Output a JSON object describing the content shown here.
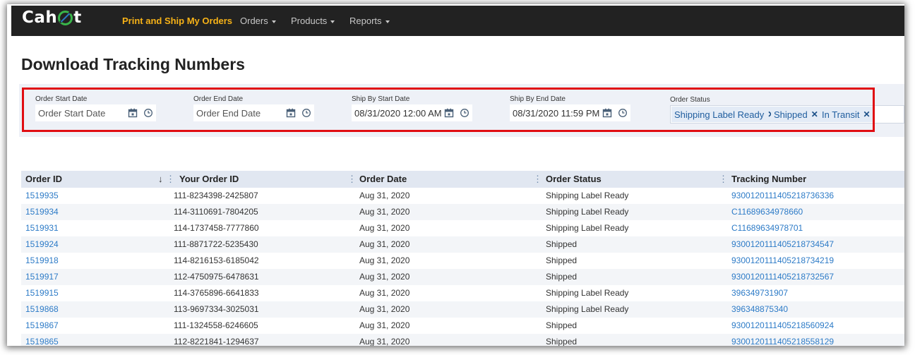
{
  "app": {
    "logo_text": "Cahoot",
    "logo_prefix": "Cah",
    "logo_suffix": "t"
  },
  "nav": {
    "print_ship": "Print and Ship My Orders",
    "orders": "Orders",
    "products": "Products",
    "reports": "Reports"
  },
  "page": {
    "title": "Download Tracking Numbers"
  },
  "filters": {
    "order_start": {
      "label": "Order Start Date",
      "placeholder": "Order Start Date",
      "value": ""
    },
    "order_end": {
      "label": "Order End Date",
      "placeholder": "Order End Date",
      "value": ""
    },
    "ship_start": {
      "label": "Ship By Start Date",
      "placeholder": "",
      "value": "08/31/2020 12:00 AM"
    },
    "ship_end": {
      "label": "Ship By End Date",
      "placeholder": "",
      "value": "08/31/2020 11:59 PM"
    },
    "order_status": {
      "label": "Order Status",
      "chips": [
        "Shipping Label Ready",
        "Shipped",
        "In Transit"
      ]
    }
  },
  "table": {
    "columns": [
      "Order ID",
      "Your Order ID",
      "Order Date",
      "Order Status",
      "Tracking Number"
    ],
    "sort_indicator": "↓",
    "rows": [
      {
        "order_id": "1519935",
        "your_order_id": "111-8234398-2425807",
        "order_date": "Aug 31, 2020",
        "status": "Shipping Label Ready",
        "tracking": "9300120111405218736336"
      },
      {
        "order_id": "1519934",
        "your_order_id": "114-3110691-7804205",
        "order_date": "Aug 31, 2020",
        "status": "Shipping Label Ready",
        "tracking": "C11689634978660"
      },
      {
        "order_id": "1519931",
        "your_order_id": "114-1737458-7777860",
        "order_date": "Aug 31, 2020",
        "status": "Shipping Label Ready",
        "tracking": "C11689634978701"
      },
      {
        "order_id": "1519924",
        "your_order_id": "111-8871722-5235430",
        "order_date": "Aug 31, 2020",
        "status": "Shipped",
        "tracking": "9300120111405218734547"
      },
      {
        "order_id": "1519918",
        "your_order_id": "114-8216153-6185042",
        "order_date": "Aug 31, 2020",
        "status": "Shipped",
        "tracking": "9300120111405218734219"
      },
      {
        "order_id": "1519917",
        "your_order_id": "112-4750975-6478631",
        "order_date": "Aug 31, 2020",
        "status": "Shipped",
        "tracking": "9300120111405218732567"
      },
      {
        "order_id": "1519915",
        "your_order_id": "114-3765896-6641833",
        "order_date": "Aug 31, 2020",
        "status": "Shipping Label Ready",
        "tracking": "396349731907"
      },
      {
        "order_id": "1519868",
        "your_order_id": "113-9697334-3025031",
        "order_date": "Aug 31, 2020",
        "status": "Shipping Label Ready",
        "tracking": "396348875340"
      },
      {
        "order_id": "1519867",
        "your_order_id": "111-1324558-6246605",
        "order_date": "Aug 31, 2020",
        "status": "Shipped",
        "tracking": "9300120111405218560924"
      },
      {
        "order_id": "1519865",
        "your_order_id": "112-8221841-1294637",
        "order_date": "Aug 31, 2020",
        "status": "Shipped",
        "tracking": "9300120111405218558129"
      }
    ]
  },
  "colors": {
    "nav_background": "#222222",
    "nav_active": "#f7b217",
    "logo_accent": "#39b54a",
    "link": "#2d7bc7",
    "highlight_border": "#e00d12",
    "header_background": "#e1e7f1",
    "chip_background": "#e3ebf6"
  }
}
